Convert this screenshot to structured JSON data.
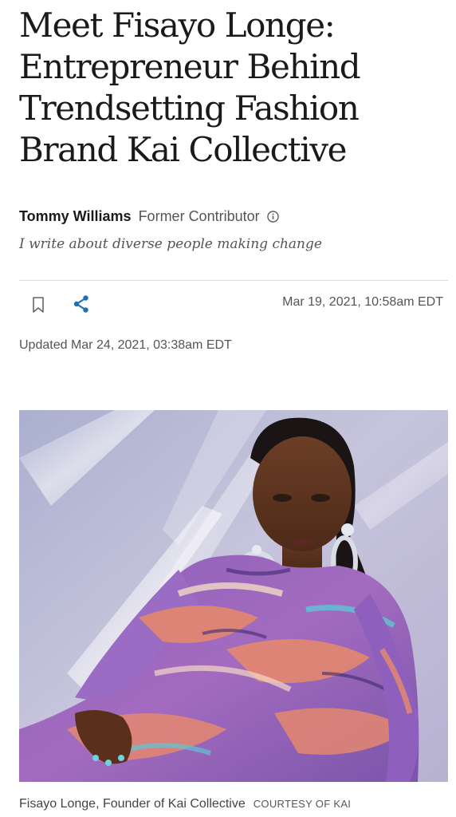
{
  "article": {
    "headline": "Meet Fisayo Longe: Entrepreneur Behind Trendsetting Fashion Brand Kai Collective",
    "author": {
      "name": "Tommy Williams",
      "role": "Former Contributor",
      "info_icon": "info-icon",
      "tagline": "I write about diverse people making change"
    },
    "actions": {
      "bookmark_icon": "bookmark-icon",
      "share_icon": "share-icon"
    },
    "published": "Mar 19, 2021, 10:58am EDT",
    "updated": "Updated Mar 24, 2021, 03:38am EDT",
    "image": {
      "caption": "Fisayo Longe, Founder of Kai Collective",
      "credit": "COURTESY OF KAI"
    }
  },
  "colors": {
    "share_accent": "#1f6fb5",
    "text_dark": "#1a1a1a",
    "text_muted": "#555555",
    "divider": "#dddddd"
  }
}
